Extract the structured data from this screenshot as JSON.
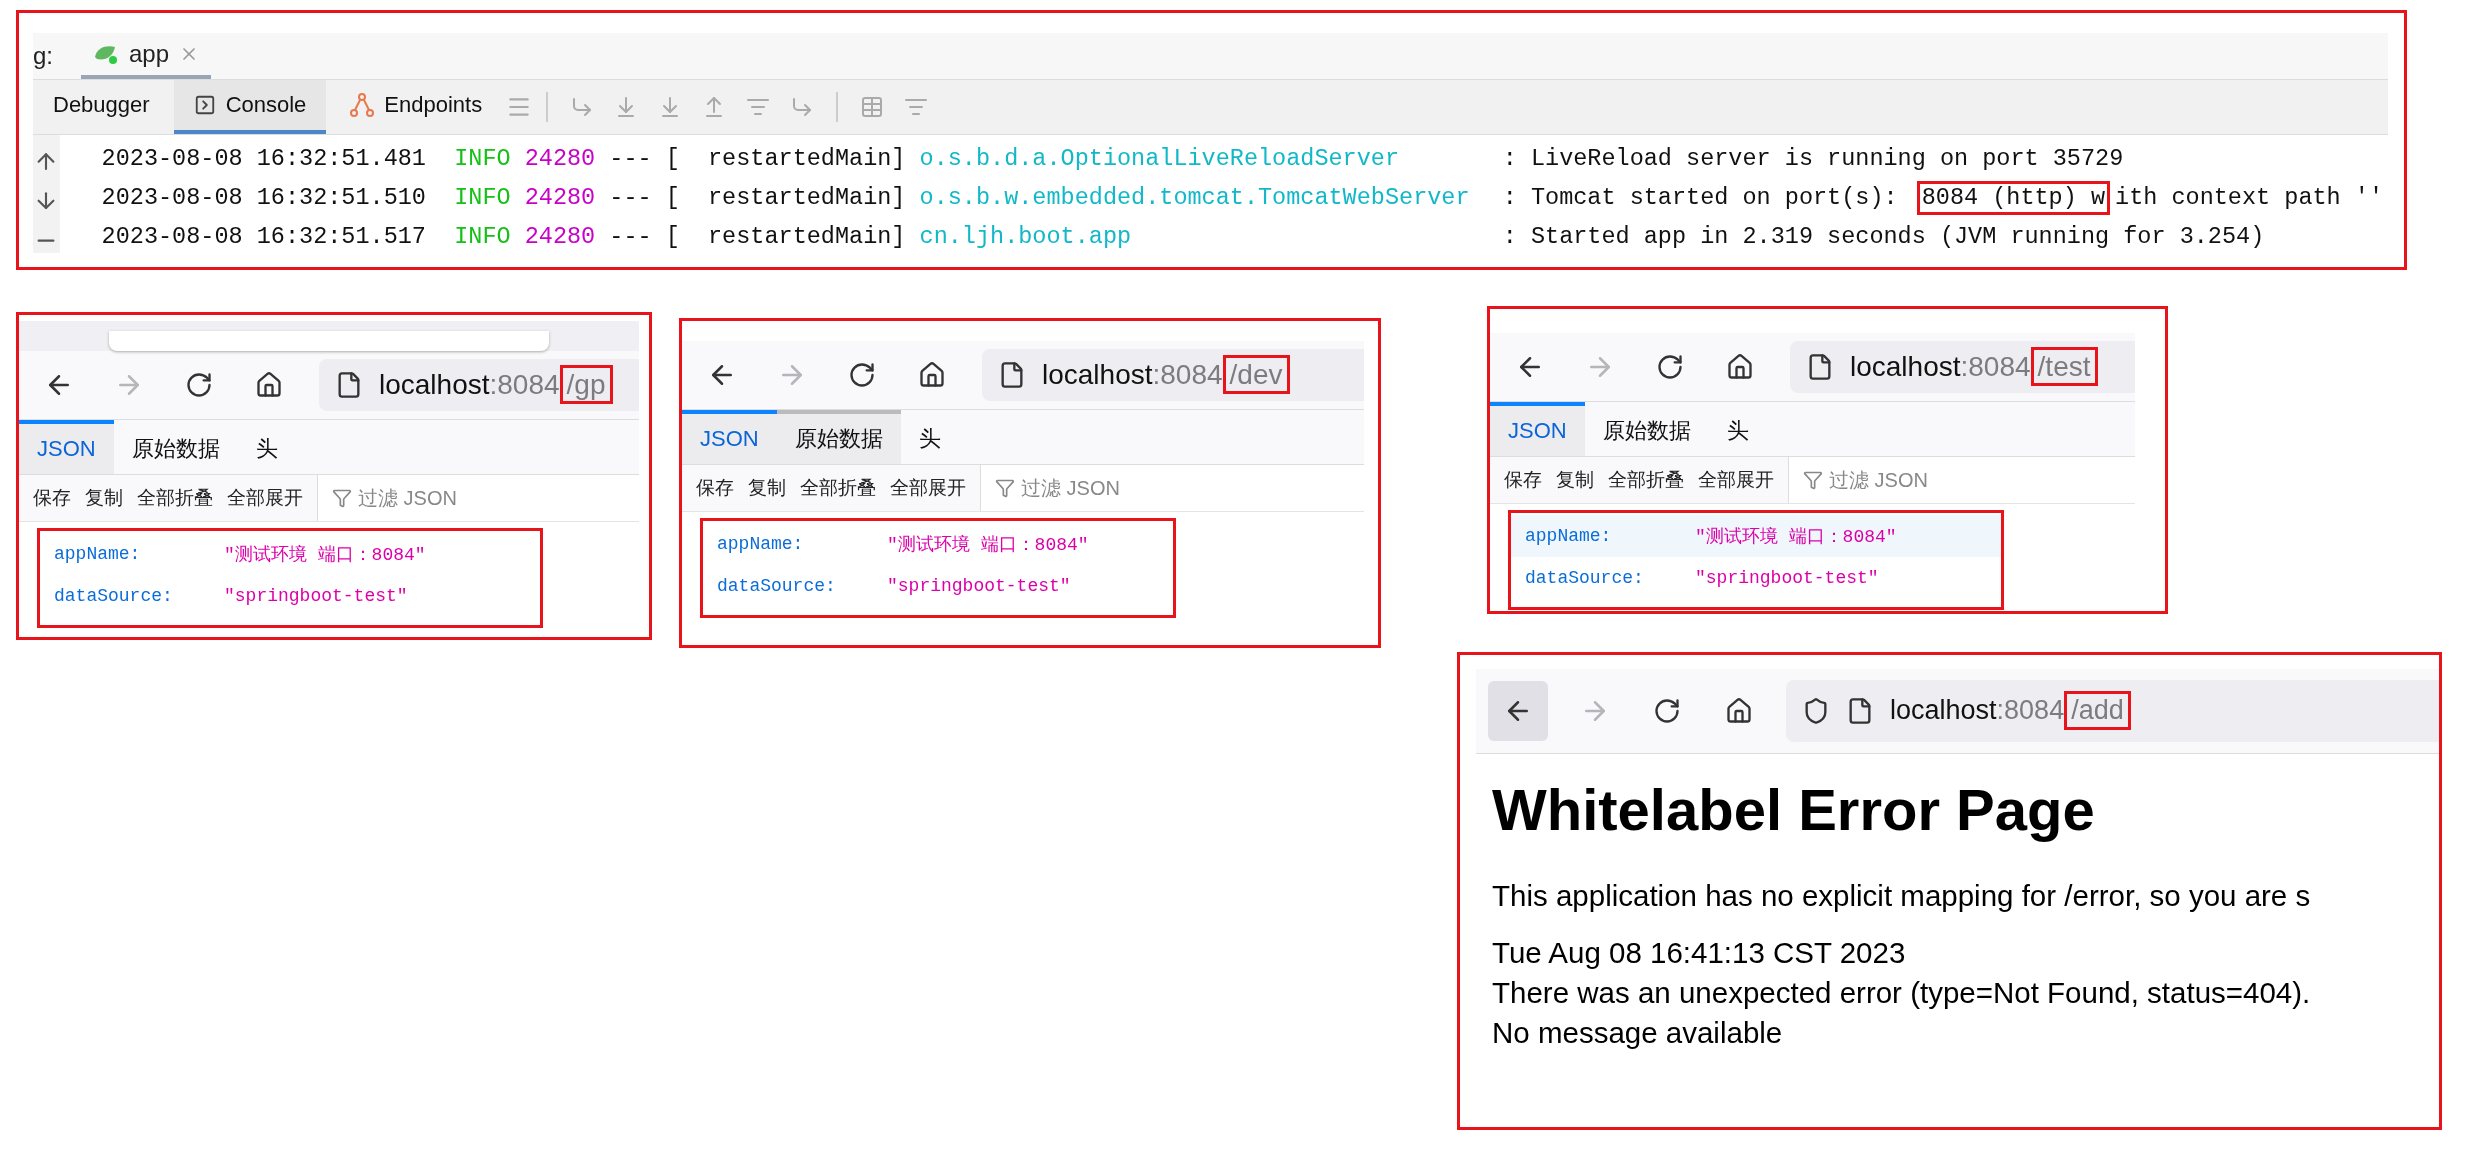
{
  "console": {
    "highlighted": true,
    "session_label": "g:",
    "run_tab": {
      "label": "app",
      "selected": true
    },
    "tabs": [
      {
        "label": "Debugger",
        "selected": false
      },
      {
        "label": "Console",
        "selected": true
      },
      {
        "label": "Endpoints",
        "selected": false
      }
    ],
    "log_lines": [
      {
        "timestamp": "2023-08-08 16:32:51.481",
        "level": "INFO",
        "pid": "24280",
        "separator": "--- [",
        "thread": "  restartedMain]",
        "logger": "o.s.b.d.a.OptionalLiveReloadServer",
        "message_parts": [
          {
            "text": ": LiveReload server is running on port 35729",
            "highlighted": false
          }
        ]
      },
      {
        "timestamp": "2023-08-08 16:32:51.510",
        "level": "INFO",
        "pid": "24280",
        "separator": "--- [",
        "thread": "  restartedMain]",
        "logger": "o.s.b.w.embedded.tomcat.TomcatWebServer",
        "message_parts": [
          {
            "text": ": Tomcat started on port(s): ",
            "highlighted": false
          },
          {
            "text": "8084 (http) w",
            "highlighted": true
          },
          {
            "text": "ith context path ''",
            "highlighted": false
          }
        ]
      },
      {
        "timestamp": "2023-08-08 16:32:51.517",
        "level": "INFO",
        "pid": "24280",
        "separator": "--- [",
        "thread": "  restartedMain]",
        "logger": "cn.ljh.boot.app",
        "message_parts": [
          {
            "text": ": Started app in 2.319 seconds (JVM running for 3.254)",
            "highlighted": false
          }
        ]
      }
    ]
  },
  "browsers": [
    {
      "kind": "json",
      "highlighted": true,
      "url": {
        "host": "localhost",
        "port": ":8084",
        "path": "/gp",
        "path_highlighted": true
      },
      "tabs": [
        {
          "label": "JSON",
          "selected": true,
          "hovered": false
        },
        {
          "label": "原始数据",
          "selected": false,
          "hovered": false
        },
        {
          "label": "头",
          "selected": false,
          "hovered": false
        }
      ],
      "actions": [
        "保存",
        "复制",
        "全部折叠",
        "全部展开"
      ],
      "filter": {
        "placeholder": "过滤 JSON"
      },
      "rows_highlighted": true,
      "rows": [
        {
          "key": "appName:",
          "value": "\"测试环境 端口：8084\"",
          "hovered": false
        },
        {
          "key": "dataSource:",
          "value": "\"springboot-test\"",
          "hovered": false
        }
      ]
    },
    {
      "kind": "json",
      "highlighted": true,
      "url": {
        "host": "localhost",
        "port": ":8084",
        "path": "/dev",
        "path_highlighted": true
      },
      "tabs": [
        {
          "label": "JSON",
          "selected": true,
          "hovered": false
        },
        {
          "label": "原始数据",
          "selected": false,
          "hovered": true
        },
        {
          "label": "头",
          "selected": false,
          "hovered": false
        }
      ],
      "actions": [
        "保存",
        "复制",
        "全部折叠",
        "全部展开"
      ],
      "filter": {
        "placeholder": "过滤 JSON"
      },
      "rows_highlighted": true,
      "rows": [
        {
          "key": "appName:",
          "value": "\"测试环境 端口：8084\"",
          "hovered": false
        },
        {
          "key": "dataSource:",
          "value": "\"springboot-test\"",
          "hovered": false
        }
      ]
    },
    {
      "kind": "json",
      "highlighted": true,
      "url": {
        "host": "localhost",
        "port": ":8084",
        "path": "/test",
        "path_highlighted": true
      },
      "tabs": [
        {
          "label": "JSON",
          "selected": true,
          "hovered": false
        },
        {
          "label": "原始数据",
          "selected": false,
          "hovered": false
        },
        {
          "label": "头",
          "selected": false,
          "hovered": false
        }
      ],
      "actions": [
        "保存",
        "复制",
        "全部折叠",
        "全部展开"
      ],
      "filter": {
        "placeholder": "过滤 JSON"
      },
      "rows_highlighted": true,
      "rows": [
        {
          "key": "appName:",
          "value": "\"测试环境 端口：8084\"",
          "hovered": true
        },
        {
          "key": "dataSource:",
          "value": "\"springboot-test\"",
          "hovered": false
        }
      ]
    },
    {
      "kind": "error",
      "highlighted": true,
      "url": {
        "host": "localhost",
        "port": ":8084",
        "path": "/add",
        "path_highlighted": true
      },
      "title": "Whitelabel Error Page",
      "paragraph": "This application has no explicit mapping for /error, so you are s",
      "details": [
        "Tue Aug 08 16:41:13 CST 2023",
        "There was an unexpected error (type=Not Found, status=404).",
        "No message available"
      ]
    }
  ]
}
